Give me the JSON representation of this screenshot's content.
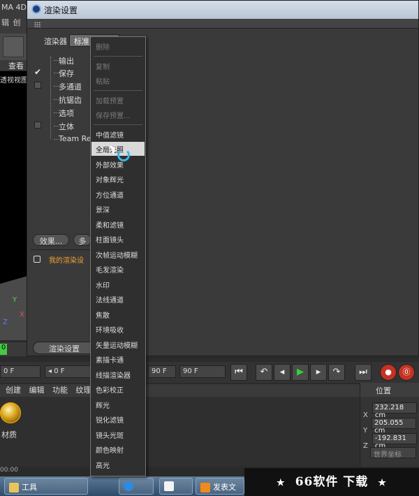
{
  "app": {
    "title": "MA 4D",
    "menu_partial": [
      "辑",
      "创"
    ],
    "viewport_tab": "查看",
    "viewport_name": "透视视图",
    "axes": [
      "Y",
      "X",
      "Z"
    ],
    "timeline_marker": "0"
  },
  "transport": {
    "start_frame": "0 F",
    "current_frame": "◂ 0 F",
    "end_frame_a": "90 F",
    "end_frame_b": "90 F",
    "buttons": [
      "⏮",
      "↶",
      "◂",
      "▶",
      "▸",
      "↷",
      "⏭"
    ],
    "record_buttons": [
      "●",
      "⓪"
    ]
  },
  "materials": {
    "menu": [
      "创建",
      "编辑",
      "功能",
      "纹理"
    ],
    "items": [
      {
        "label": "材质"
      }
    ]
  },
  "coordinates": {
    "title": "位置",
    "rows": [
      {
        "axis": "X",
        "value": "232.218 cm"
      },
      {
        "axis": "Y",
        "value": "205.055 cm"
      },
      {
        "axis": "Z",
        "value": "-192.831 cm"
      }
    ],
    "space": "世界坐标"
  },
  "status_bar": "00:00",
  "taskbar": {
    "items": [
      {
        "label": "工具"
      },
      {
        "label": ""
      },
      {
        "label": ""
      },
      {
        "label": "发表文"
      }
    ]
  },
  "watermark": {
    "star": "★",
    "text": "66软件 下载"
  },
  "dialog": {
    "title": "渲染设置",
    "renderer_label": "渲染器",
    "renderer_value": "标准",
    "tree": [
      {
        "label": "输出",
        "check": "none"
      },
      {
        "label": "保存",
        "check": "tick"
      },
      {
        "label": "多通道",
        "check": "box"
      },
      {
        "label": "抗锯齿",
        "check": "none"
      },
      {
        "label": "选项",
        "check": "none"
      },
      {
        "label": "立体",
        "check": "box"
      },
      {
        "label": "Team Ren",
        "check": "none"
      }
    ],
    "effect_button": "效果...",
    "multi_button": "多",
    "preset_label": "我的渲染设",
    "render_button": "渲染设置"
  },
  "context_menu": {
    "items": [
      {
        "label": "删除",
        "disabled": true
      },
      {
        "sep": true
      },
      {
        "label": "复制",
        "disabled": true
      },
      {
        "label": "粘贴",
        "disabled": true
      },
      {
        "sep": true
      },
      {
        "label": "加载预置",
        "disabled": true
      },
      {
        "label": "保存预置...",
        "disabled": true
      },
      {
        "sep": true
      },
      {
        "label": "中值滤镜"
      },
      {
        "label": "全局光照",
        "highlight": true
      },
      {
        "label": "外部效果"
      },
      {
        "label": "对象辉光"
      },
      {
        "label": "方位通道"
      },
      {
        "label": "景深"
      },
      {
        "label": "柔和滤镜"
      },
      {
        "label": "柱面镜头"
      },
      {
        "label": "次帧运动模糊"
      },
      {
        "label": "毛发渲染"
      },
      {
        "label": "水印"
      },
      {
        "label": "法线通道"
      },
      {
        "label": "焦散"
      },
      {
        "label": "环境吸收"
      },
      {
        "label": "矢量运动模糊"
      },
      {
        "label": "素描卡通"
      },
      {
        "label": "线描渲染器"
      },
      {
        "label": "色彩校正"
      },
      {
        "label": "辉光"
      },
      {
        "label": "锐化滤镜"
      },
      {
        "label": "镜头光斑"
      },
      {
        "label": "颜色映射"
      },
      {
        "label": "高光"
      }
    ]
  },
  "colors": {
    "highlight_bg": "#d9d9d9",
    "accent_orange": "#f0a030",
    "play_green": "#36d136",
    "record_red": "#c43224"
  }
}
